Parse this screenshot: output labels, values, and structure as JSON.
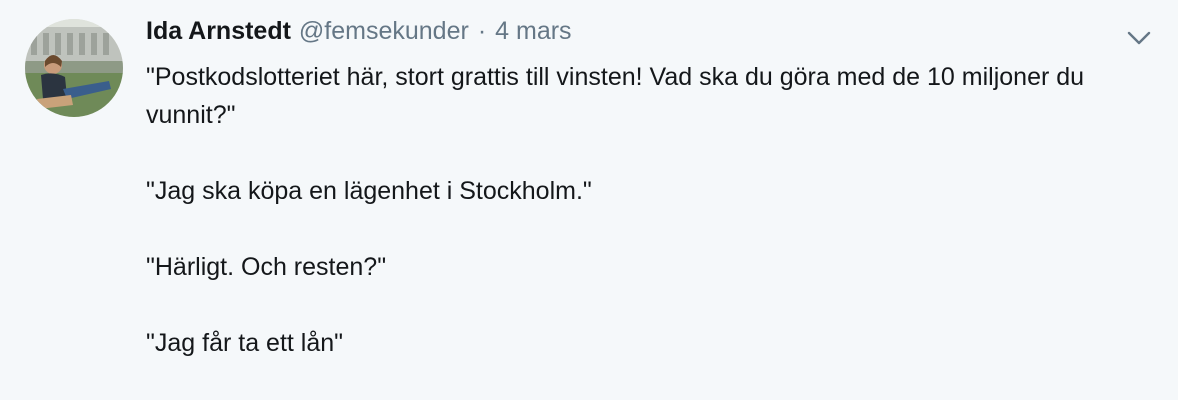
{
  "tweet": {
    "author_name": "Ida Arnstedt",
    "handle": "@femsekunder",
    "separator": "·",
    "date": "4 mars",
    "paragraphs": [
      "\"Postkodslotteriet här, stort grattis till vinsten! Vad ska du göra med de 10 miljoner du vunnit?\"",
      "\"Jag ska köpa en lägenhet i Stockholm.\"",
      "\"Härligt. Och resten?\"",
      "\"Jag får ta ett lån\""
    ]
  },
  "icons": {
    "avatar": "profile-photo",
    "menu": "chevron-down-icon"
  },
  "colors": {
    "background": "#f5f8fa",
    "text": "#14171a",
    "secondary_text": "#657786"
  }
}
